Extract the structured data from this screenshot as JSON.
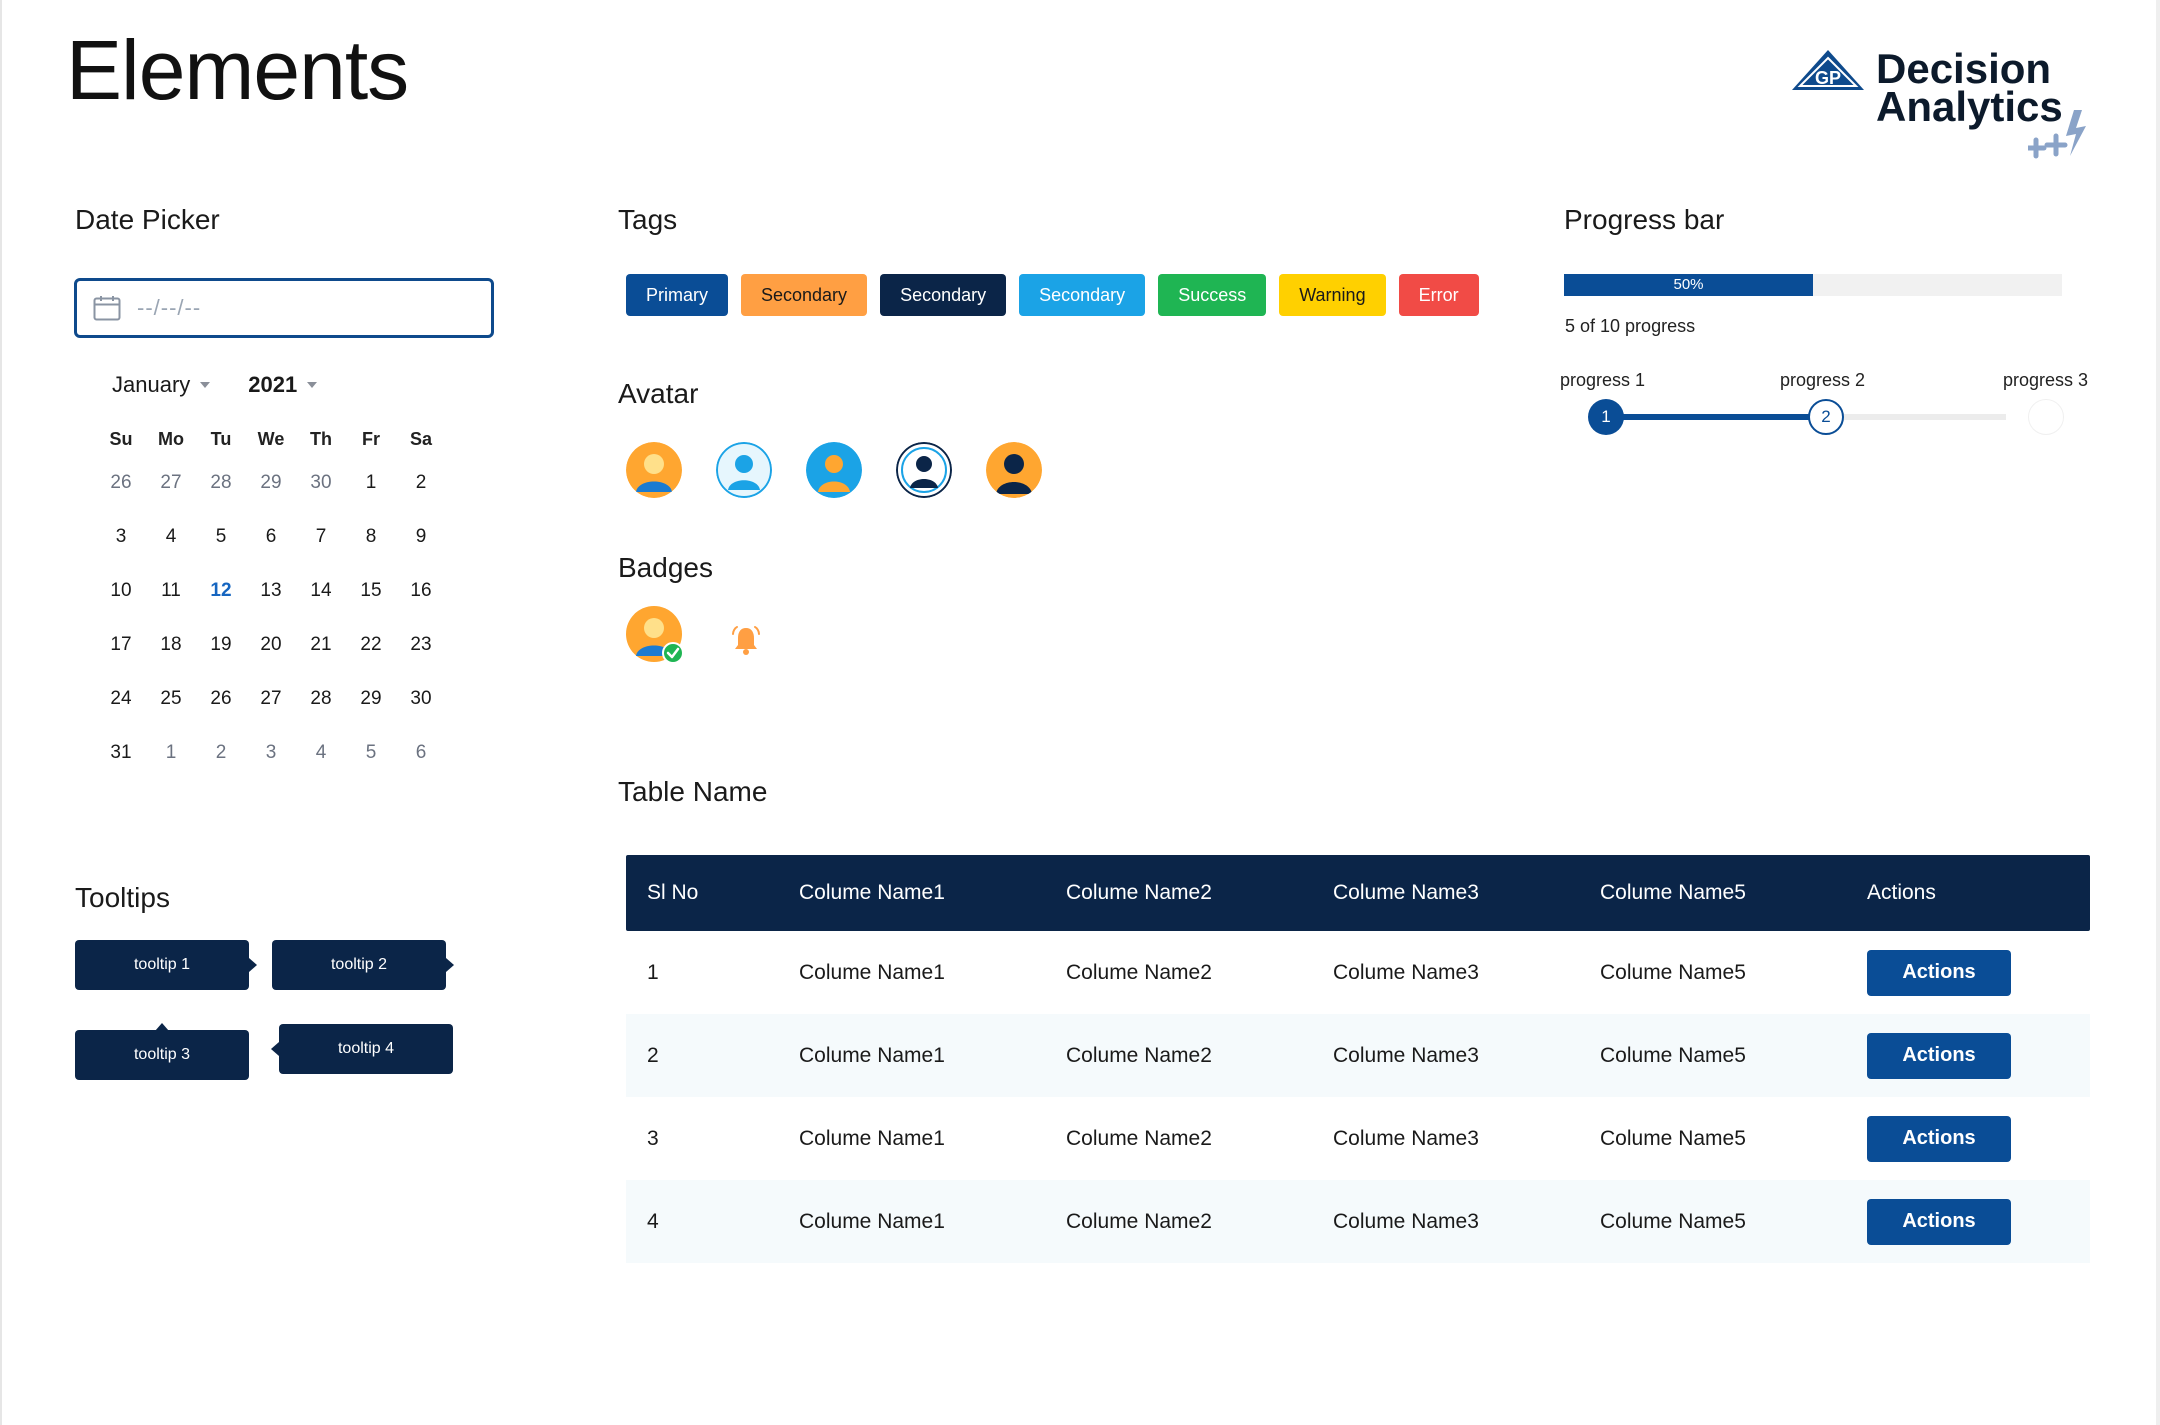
{
  "page": {
    "title": "Elements"
  },
  "logo": {
    "mark_text": "GP",
    "line1": "Decision",
    "line2": "Analytics"
  },
  "date_picker": {
    "title": "Date Picker",
    "placeholder": "--/--/--",
    "month": "January",
    "year": "2021",
    "weekdays": [
      "Su",
      "Mo",
      "Tu",
      "We",
      "Th",
      "Fr",
      "Sa"
    ],
    "weeks": [
      [
        "26",
        "27",
        "28",
        "29",
        "30",
        "1",
        "2"
      ],
      [
        "3",
        "4",
        "5",
        "6",
        "7",
        "8",
        "9"
      ],
      [
        "10",
        "11",
        "12",
        "13",
        "14",
        "15",
        "16"
      ],
      [
        "17",
        "18",
        "19",
        "20",
        "21",
        "22",
        "23"
      ],
      [
        "24",
        "25",
        "26",
        "27",
        "28",
        "29",
        "30"
      ],
      [
        "31",
        "1",
        "2",
        "3",
        "4",
        "5",
        "6"
      ]
    ],
    "selected_day": "12"
  },
  "tooltips": {
    "title": "Tooltips",
    "items": [
      "tooltip 1",
      "tooltip 2",
      "tooltip 3",
      "tooltip 4"
    ]
  },
  "tags": {
    "title": "Tags",
    "items": [
      {
        "label": "Primary",
        "bg": "#0a4d96",
        "fg": "#ffffff"
      },
      {
        "label": "Secondary",
        "bg": "#ff9f43",
        "fg": "#1a1a1a"
      },
      {
        "label": "Secondary",
        "bg": "#0b2548",
        "fg": "#ffffff"
      },
      {
        "label": "Secondary",
        "bg": "#1ba3e6",
        "fg": "#ffffff"
      },
      {
        "label": "Success",
        "bg": "#1fb553",
        "fg": "#ffffff"
      },
      {
        "label": "Warning",
        "bg": "#ffd000",
        "fg": "#1a1a1a"
      },
      {
        "label": "Error",
        "bg": "#f14b46",
        "fg": "#ffffff"
      }
    ]
  },
  "avatar": {
    "title": "Avatar"
  },
  "badges": {
    "title": "Badges"
  },
  "progress": {
    "title": "Progress bar",
    "percent": 50,
    "percent_label": "50%",
    "caption": "5 of 10 progress",
    "steps": [
      "progress 1",
      "progress 2",
      "progress 3"
    ],
    "step_numbers": [
      "1",
      "2"
    ],
    "current_step": 2
  },
  "table": {
    "title": "Table Name",
    "columns": [
      "Sl No",
      "Colume Name1",
      "Colume Name2",
      "Colume Name3",
      "Colume Name5",
      "Actions"
    ],
    "rows": [
      [
        "1",
        "Colume Name1",
        "Colume Name2",
        "Colume Name3",
        "Colume Name5"
      ],
      [
        "2",
        "Colume Name1",
        "Colume Name2",
        "Colume Name3",
        "Colume Name5"
      ],
      [
        "3",
        "Colume Name1",
        "Colume Name2",
        "Colume Name3",
        "Colume Name5"
      ],
      [
        "4",
        "Colume Name1",
        "Colume Name2",
        "Colume Name3",
        "Colume Name5"
      ]
    ],
    "action_label": "Actions"
  },
  "colors": {
    "primary": "#0a4d96",
    "navy": "#0b2548",
    "orange": "#ff9f43",
    "success": "#1fb553"
  }
}
